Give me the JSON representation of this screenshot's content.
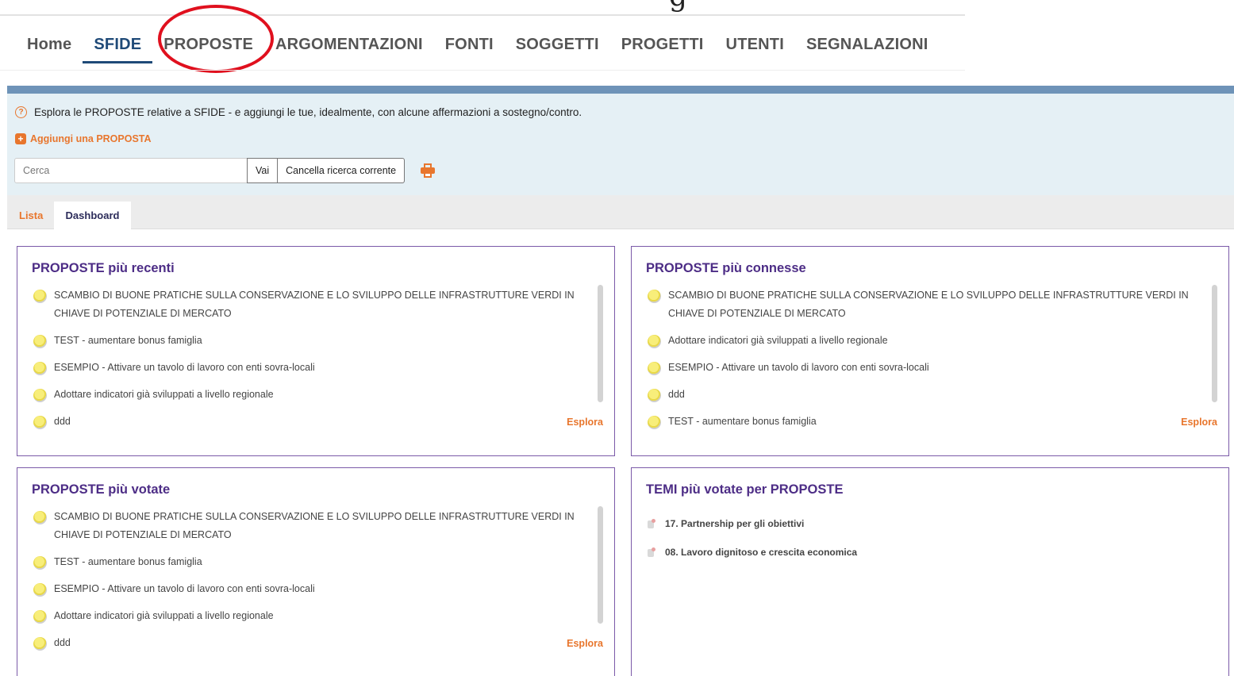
{
  "nav": {
    "items": [
      {
        "label": "Home",
        "active": false
      },
      {
        "label": "SFIDE",
        "active": true
      },
      {
        "label": "PROPOSTE",
        "active": false
      },
      {
        "label": "ARGOMENTAZIONI",
        "active": false
      },
      {
        "label": "FONTI",
        "active": false
      },
      {
        "label": "SOGGETTI",
        "active": false
      },
      {
        "label": "PROGETTI",
        "active": false
      },
      {
        "label": "UTENTI",
        "active": false
      },
      {
        "label": "SEGNALAZIONI",
        "active": false
      }
    ],
    "highlighted_item": "PROPOSTE"
  },
  "top_glyph": "g",
  "info": {
    "help_icon": "question-circle-icon",
    "text": "Esplora le PROPOSTE relative a SFIDE - e aggiungi le tue, idealmente, con alcune affermazioni a sostegno/contro.",
    "add_label": "Aggiungi una PROPOSTA"
  },
  "search": {
    "placeholder": "Cerca",
    "value": "",
    "go_label": "Vai",
    "clear_label": "Cancella ricerca corrente",
    "print_icon": "printer-icon"
  },
  "tabs": [
    {
      "label": "Lista",
      "active": false
    },
    {
      "label": "Dashboard",
      "active": true
    }
  ],
  "cards": {
    "recent": {
      "title": "PROPOSTE più recenti",
      "items": [
        "SCAMBIO DI BUONE PRATICHE SULLA CONSERVAZIONE E LO SVILUPPO DELLE INFRASTRUTTURE VERDI IN CHIAVE DI POTENZIALE DI MERCATO",
        "TEST - aumentare bonus famiglia",
        "ESEMPIO - Attivare un tavolo di lavoro con enti sovra-locali",
        "Adottare indicatori già sviluppati a livello regionale",
        "ddd"
      ],
      "explore_label": "Esplora"
    },
    "connected": {
      "title": "PROPOSTE più connesse",
      "items": [
        "SCAMBIO DI BUONE PRATICHE SULLA CONSERVAZIONE E LO SVILUPPO DELLE INFRASTRUTTURE VERDI IN CHIAVE DI POTENZIALE DI MERCATO",
        "Adottare indicatori già sviluppati a livello regionale",
        "ESEMPIO - Attivare un tavolo di lavoro con enti sovra-locali",
        "ddd",
        "TEST - aumentare bonus famiglia"
      ],
      "explore_label": "Esplora"
    },
    "voted": {
      "title": "PROPOSTE più votate",
      "items": [
        "SCAMBIO DI BUONE PRATICHE SULLA CONSERVAZIONE E LO SVILUPPO DELLE INFRASTRUTTURE VERDI IN CHIAVE DI POTENZIALE DI MERCATO",
        "TEST - aumentare bonus famiglia",
        "ESEMPIO - Attivare un tavolo di lavoro con enti sovra-locali",
        "Adottare indicatori già sviluppati a livello regionale",
        "ddd"
      ],
      "explore_label": "Esplora"
    },
    "themes": {
      "title": "TEMI più votate per PROPOSTE",
      "items": [
        "17. Partnership per gli obiettivi",
        "08. Lavoro dignitoso e crescita economica"
      ]
    }
  },
  "colors": {
    "accent_orange": "#e8762d",
    "nav_active": "#1f4a78",
    "card_border": "#7b5aa8",
    "card_title": "#4d2d86",
    "highlight_circle": "#e0101e",
    "info_bg": "#e5f0f5",
    "blue_bar": "#6e93b8"
  }
}
